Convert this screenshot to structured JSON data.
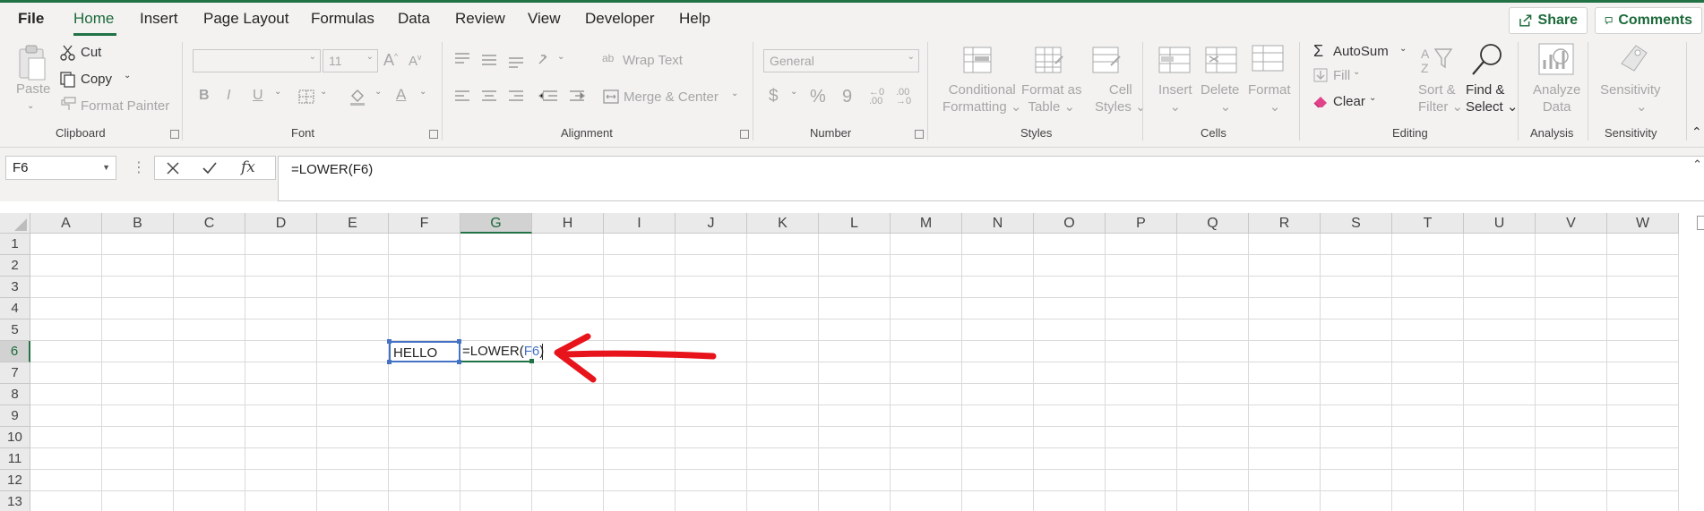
{
  "menu": {
    "file": "File",
    "tabs": [
      "Home",
      "Insert",
      "Page Layout",
      "Formulas",
      "Data",
      "Review",
      "View",
      "Developer",
      "Help"
    ],
    "active_tab": "Home",
    "share": "Share",
    "comments": "Comments"
  },
  "ribbon": {
    "clipboard": {
      "label": "Clipboard",
      "paste": "Paste",
      "cut": "Cut",
      "copy": "Copy",
      "format_painter": "Format Painter"
    },
    "font": {
      "label": "Font",
      "font_name": "",
      "font_size": "11",
      "bold": "B",
      "italic": "I",
      "underline": "U"
    },
    "alignment": {
      "label": "Alignment",
      "wrap_text": "Wrap Text",
      "merge_center": "Merge & Center"
    },
    "number": {
      "label": "Number",
      "format": "General",
      "currency": "$",
      "percent": "%",
      "comma": "9"
    },
    "styles": {
      "label": "Styles",
      "conditional_formatting": [
        "Conditional",
        "Formatting"
      ],
      "format_as_table": [
        "Format as",
        "Table"
      ],
      "cell_styles": [
        "Cell",
        "Styles"
      ]
    },
    "cells": {
      "label": "Cells",
      "insert": "Insert",
      "delete": "Delete",
      "format": "Format"
    },
    "editing": {
      "label": "Editing",
      "autosum": "AutoSum",
      "fill": "Fill",
      "clear": "Clear",
      "sort_filter": [
        "Sort &",
        "Filter"
      ],
      "find_select": [
        "Find &",
        "Select"
      ]
    },
    "analysis": {
      "label": "Analysis",
      "analyze_data": [
        "Analyze",
        "Data"
      ]
    },
    "sensitivity": {
      "label": "Sensitivity",
      "sensitivity": "Sensitivity"
    }
  },
  "formula_bar": {
    "name_box": "F6",
    "formula": "=LOWER(F6)",
    "fx": "fx"
  },
  "sheet": {
    "columns": [
      "A",
      "B",
      "C",
      "D",
      "E",
      "F",
      "G",
      "H",
      "I",
      "J",
      "K",
      "L",
      "M",
      "N",
      "O",
      "P",
      "Q",
      "R",
      "S",
      "T",
      "U",
      "V",
      "W"
    ],
    "rows": [
      "1",
      "2",
      "3",
      "4",
      "5",
      "6",
      "7",
      "8",
      "9",
      "10",
      "11",
      "12",
      "13"
    ],
    "selected_column": "G",
    "selected_row": "6",
    "cells": {
      "F6": "HELLO",
      "G6_prefix": "=LOWER(",
      "G6_ref": "F6",
      "G6_suffix": ")"
    }
  },
  "colors": {
    "accent": "#217346",
    "reference": "#4472c4",
    "annotation": "#e8141b"
  }
}
